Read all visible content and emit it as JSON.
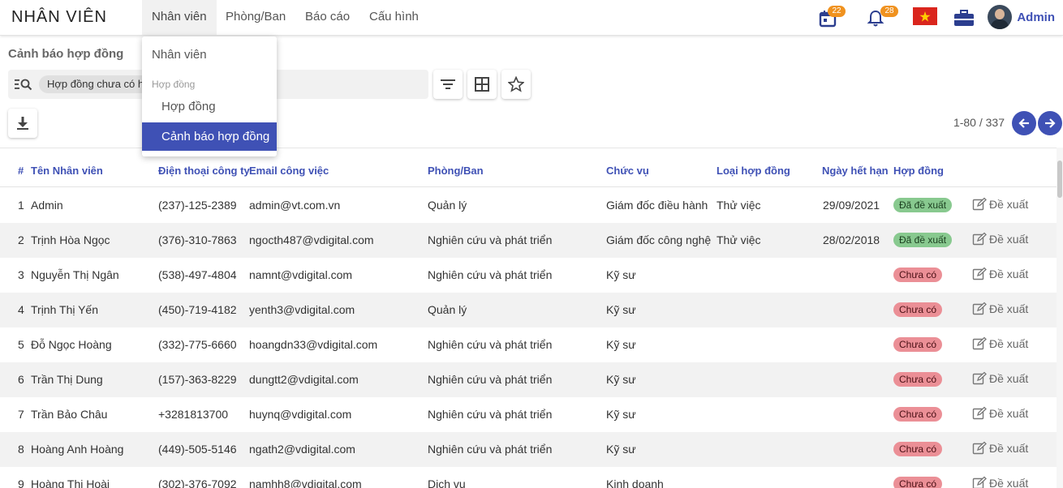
{
  "app": {
    "title": "NHÂN VIÊN"
  },
  "nav": {
    "items": [
      "Nhân viên",
      "Phòng/Ban",
      "Báo cáo",
      "Cấu hình"
    ]
  },
  "header": {
    "calendar_badge": "22",
    "bell_badge": "28",
    "user_name": "Admin"
  },
  "page": {
    "title": "Cảnh báo hợp đồng"
  },
  "search": {
    "chip": "Hợp đồng chưa có hiệu lực"
  },
  "pager": {
    "text": "1-80 / 337"
  },
  "dropdown": {
    "item1": "Nhân viên",
    "group": "Hợp đồng",
    "item2": "Hợp đồng",
    "item3": "Cảnh báo hợp đồng"
  },
  "table": {
    "columns": [
      "#",
      "Tên Nhân viên",
      "Điện thoại công ty",
      "Email công việc",
      "Phòng/Ban",
      "Chức vụ",
      "Loại hợp đồng",
      "Ngày hết hạn",
      "Hợp đồng"
    ],
    "action_label": "Đề xuất",
    "rows": [
      {
        "no": "1",
        "name": "Admin",
        "phone": "(237)-125-2389",
        "email": "admin@vt.com.vn",
        "dept": "Quản lý",
        "position": "Giám đốc điều hành",
        "type": "Thử việc",
        "expiry": "29/09/2021",
        "status": "Đã đề xuất"
      },
      {
        "no": "2",
        "name": "Trịnh Hòa Ngọc",
        "phone": "(376)-310-7863",
        "email": "ngocth487@vdigital.com",
        "dept": "Nghiên cứu và phát triển",
        "position": "Giám đốc công nghệ",
        "type": "Thử việc",
        "expiry": "28/02/2018",
        "status": "Đã đề xuất"
      },
      {
        "no": "3",
        "name": "Nguyễn Thị Ngân",
        "phone": "(538)-497-4804",
        "email": "namnt@vdigital.com",
        "dept": "Nghiên cứu và phát triển",
        "position": "Kỹ sư",
        "type": "",
        "expiry": "",
        "status": "Chưa có"
      },
      {
        "no": "4",
        "name": "Trịnh Thị Yến",
        "phone": "(450)-719-4182",
        "email": "yenth3@vdigital.com",
        "dept": "Quản lý",
        "position": "Kỹ sư",
        "type": "",
        "expiry": "",
        "status": "Chưa có"
      },
      {
        "no": "5",
        "name": "Đỗ Ngọc Hoàng",
        "phone": "(332)-775-6660",
        "email": "hoangdn33@vdigital.com",
        "dept": "Nghiên cứu và phát triển",
        "position": "Kỹ sư",
        "type": "",
        "expiry": "",
        "status": "Chưa có"
      },
      {
        "no": "6",
        "name": "Trần Thị Dung",
        "phone": "(157)-363-8229",
        "email": "dungtt2@vdigital.com",
        "dept": "Nghiên cứu và phát triển",
        "position": "Kỹ sư",
        "type": "",
        "expiry": "",
        "status": "Chưa có"
      },
      {
        "no": "7",
        "name": "Trần Bảo Châu",
        "phone": "+3281813700",
        "email": "huynq@vdigital.com",
        "dept": "Nghiên cứu và phát triển",
        "position": "Kỹ sư",
        "type": "",
        "expiry": "",
        "status": "Chưa có"
      },
      {
        "no": "8",
        "name": "Hoàng Anh Hoàng",
        "phone": "(449)-505-5146",
        "email": "ngath2@vdigital.com",
        "dept": "Nghiên cứu và phát triển",
        "position": "Kỹ sư",
        "type": "",
        "expiry": "",
        "status": "Chưa có"
      },
      {
        "no": "9",
        "name": "Hoàng Thị Hoài",
        "phone": "(302)-376-7092",
        "email": "namhh8@vdigital.com",
        "dept": "Dịch vụ",
        "position": "Kinh doanh",
        "type": "",
        "expiry": "",
        "status": "Chưa có"
      }
    ]
  },
  "colors": {
    "accent": "#3f51b5",
    "badge": "#f0921f",
    "status_ok": "#88c98f",
    "status_no": "#eb8f96"
  },
  "icons": [
    "calendar-icon",
    "bell-icon",
    "vietnam-flag-icon",
    "briefcase-icon",
    "search-list-icon",
    "filter-icon",
    "grid-icon",
    "star-icon",
    "download-icon",
    "arrow-left-icon",
    "arrow-right-icon",
    "edit-icon"
  ]
}
